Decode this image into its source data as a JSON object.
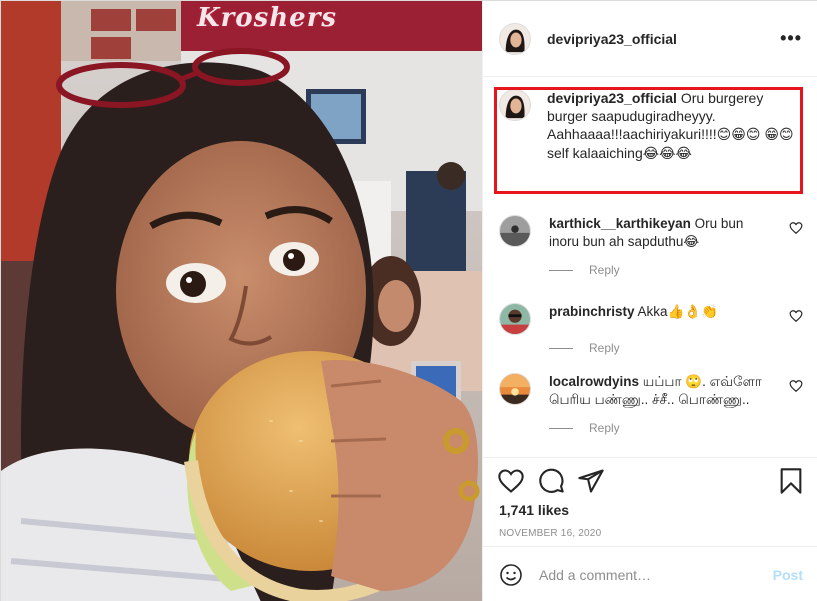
{
  "photo": {
    "sign_text": "Kroshers"
  },
  "header": {
    "username": "devipriya23_official",
    "more_icon": "more-horizontal-icon"
  },
  "caption": {
    "username": "devipriya23_official",
    "text_line1": "Oru burgerey burger saapudugiradheyyy.",
    "text_line2": "Aahhaaaa!!!aachiriyakuri!!!!",
    "emoji_a": "😊😁😊",
    "emoji_b": "😁😊",
    "text_line3": "self kalaaiching",
    "emoji_c": "😂😂😂"
  },
  "comments": [
    {
      "username": "karthick__karthikeyan",
      "text": "Oru bun inoru bun ah sapduthu",
      "emoji": "😂",
      "reply": "Reply"
    },
    {
      "username": "prabinchristy",
      "text": "Akka",
      "emoji": "👍👌👏",
      "reply": "Reply"
    },
    {
      "username": "localrowdyins",
      "text": "யப்பா 🙄. எவ்ளோ பெரிய பண்ணு.. ச்சீ.. பொண்ணு..",
      "emoji": "",
      "reply": "Reply"
    }
  ],
  "actions": {
    "likes": "1,741 likes",
    "date": "NOVEMBER 16, 2020"
  },
  "add_comment": {
    "placeholder": "Add a comment…",
    "post_label": "Post"
  },
  "colors": {
    "highlight_border": "#e8141c",
    "post_disabled": "#b2dffc",
    "muted": "#8e8e8e"
  }
}
